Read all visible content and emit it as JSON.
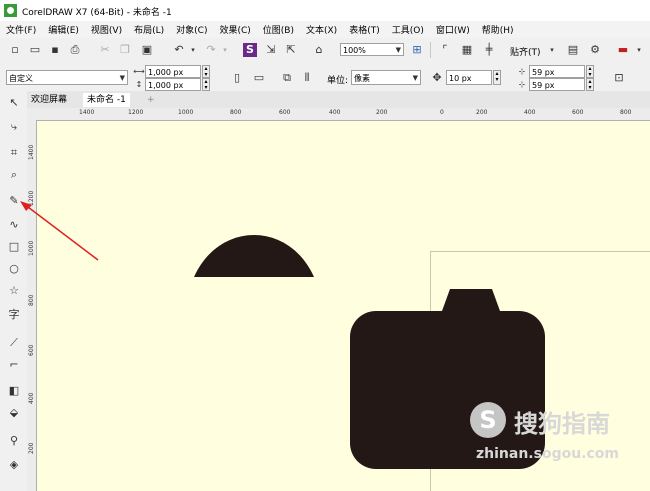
{
  "window": {
    "title": "CorelDRAW X7 (64-Bit) - 未命名 -1"
  },
  "menu": [
    {
      "label": "文件(F)"
    },
    {
      "label": "编辑(E)"
    },
    {
      "label": "视图(V)"
    },
    {
      "label": "布局(L)"
    },
    {
      "label": "对象(C)"
    },
    {
      "label": "效果(C)"
    },
    {
      "label": "位图(B)"
    },
    {
      "label": "文本(X)"
    },
    {
      "label": "表格(T)"
    },
    {
      "label": "工具(O)"
    },
    {
      "label": "窗口(W)"
    },
    {
      "label": "帮助(H)"
    }
  ],
  "toolbar": {
    "zoom_value": "100%",
    "snap_label": "贴齐(T)"
  },
  "property_bar": {
    "preset": "自定义",
    "width": "1,000 px",
    "height": "1,000 px",
    "units_label": "单位:",
    "units_value": "像素",
    "nudge": "10 px",
    "dup_x": "59 px",
    "dup_y": "59 px"
  },
  "tabs": {
    "welcome": "欢迎屏幕",
    "document": "未命名 -1",
    "add": "+"
  },
  "ruler_h": [
    "1400",
    "1200",
    "1000",
    "800",
    "600",
    "400",
    "200",
    "0",
    "200",
    "400",
    "600",
    "800"
  ],
  "ruler_v": [
    "1400",
    "1200",
    "1000",
    "800",
    "600",
    "400",
    "200"
  ],
  "watermark": {
    "badge": "S",
    "text": "搜狗指南",
    "url": "zhinan.sogou.com"
  },
  "colors": {
    "canvas": "#fffede",
    "shape_fill": "#231815",
    "annotation_arrow": "#e02020"
  }
}
